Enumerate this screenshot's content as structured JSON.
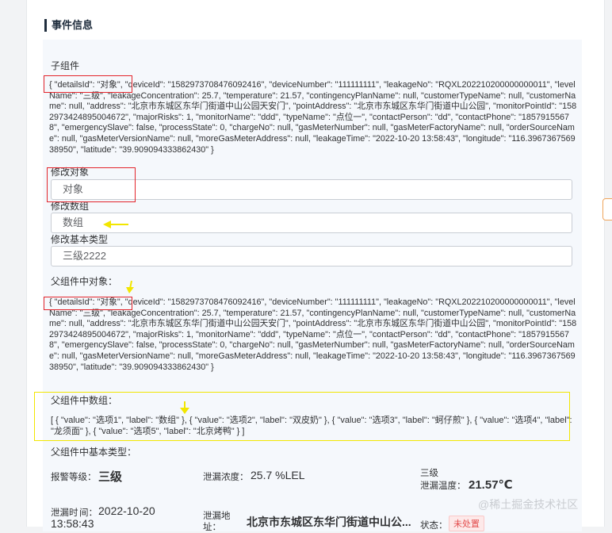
{
  "section": {
    "title": "事件信息"
  },
  "child": {
    "label": "子组件",
    "json_text": "{ \"detailsId\": \"对象\", \"deviceId\": \"1582973708476092416\", \"deviceNumber\": \"111111111\", \"leakageNo\": \"RQXL202210200000000011\", \"levelName\": \"三级\", \"leakageConcentration\": 25.7, \"temperature\": 21.57, \"contingencyPlanName\": null, \"customerTypeName\": null, \"customerName\": null, \"address\": \"北京市东城区东华门街道中山公园天安门\", \"pointAddress\": \"北京市东城区东华门街道中山公园\", \"monitorPointId\": \"1582973424895004672\", \"majorRisks\": 1, \"monitorName\": \"ddd\", \"typeName\": \"点位一\", \"contactPerson\": \"dd\", \"contactPhone\": \"18579155678\", \"emergencySlave\": false, \"processState\": 0, \"chargeNo\": null, \"gasMeterNumber\": null, \"gasMeterFactoryName\": null, \"orderSourceName\": null, \"gasMeterVersionName\": null, \"moreGasMeterAddress\": null, \"leakageTime\": \"2022-10-20 13:58:43\", \"longitude\": \"116.396736756938950\", \"latitude\": \"39.909094333862430\" }"
  },
  "modify_object": {
    "label": "修改对象",
    "value": "对象"
  },
  "modify_array": {
    "label": "修改数组",
    "value": "数组"
  },
  "modify_basic": {
    "label": "修改基本类型",
    "value": "三级2222"
  },
  "parent_object": {
    "label": "父组件中对象：",
    "json_text": "{ \"detailsId\": \"对象\", \"deviceId\": \"1582973708476092416\", \"deviceNumber\": \"111111111\", \"leakageNo\": \"RQXL202210200000000011\", \"levelName\": \"三级\", \"leakageConcentration\": 25.7, \"temperature\": 21.57, \"contingencyPlanName\": null, \"customerTypeName\": null, \"customerName\": null, \"address\": \"北京市东城区东华门街道中山公园天安门\", \"pointAddress\": \"北京市东城区东华门街道中山公园\", \"monitorPointId\": \"1582973424895004672\", \"majorRisks\": 1, \"monitorName\": \"ddd\", \"typeName\": \"点位一\", \"contactPerson\": \"dd\", \"contactPhone\": \"18579155678\", \"emergencySlave\": false, \"processState\": 0, \"chargeNo\": null, \"gasMeterNumber\": null, \"gasMeterFactoryName\": null, \"orderSourceName\": null, \"gasMeterVersionName\": null, \"moreGasMeterAddress\": null, \"leakageTime\": \"2022-10-20 13:58:43\", \"longitude\": \"116.396736756938950\", \"latitude\": \"39.909094333862430\" }"
  },
  "parent_array": {
    "label": "父组件中数组：",
    "json_text": "[ { \"value\": \"选项1\", \"label\": \"数组\" }, { \"value\": \"选项2\", \"label\": \"双皮奶\" }, { \"value\": \"选项3\", \"label\": \"蚵仔煎\" }, { \"value\": \"选项4\", \"label\": \"龙须面\" }, { \"value\": \"选项5\", \"label\": \"北京烤鸭\" } ]"
  },
  "parent_basic": {
    "label": "父组件中基本类型："
  },
  "stats": {
    "alarm_level_label": "报警等级：",
    "alarm_level_value": "三级",
    "concentration_label": "泄漏浓度：",
    "concentration_value": "25.7 %LEL",
    "temp_line1": "三级",
    "temp_label": "泄漏温度：",
    "temp_value": "21.57℃",
    "time_label_1": "泄漏时",
    "time_label_2": "间：",
    "time_value_1": "2022-10-20",
    "time_value_2": "13:58:43",
    "addr_label_1": "泄漏地",
    "addr_label_2": "址：",
    "addr_value": "北京市东城区东华门街道中山公...",
    "state_label": "状态：",
    "state_value": "未处置"
  },
  "watermark": "@稀土掘金技术社区",
  "colors": {
    "annotation_red": "#e3242b",
    "annotation_yellow": "#f2e600",
    "status_red": "#e34d4d"
  }
}
